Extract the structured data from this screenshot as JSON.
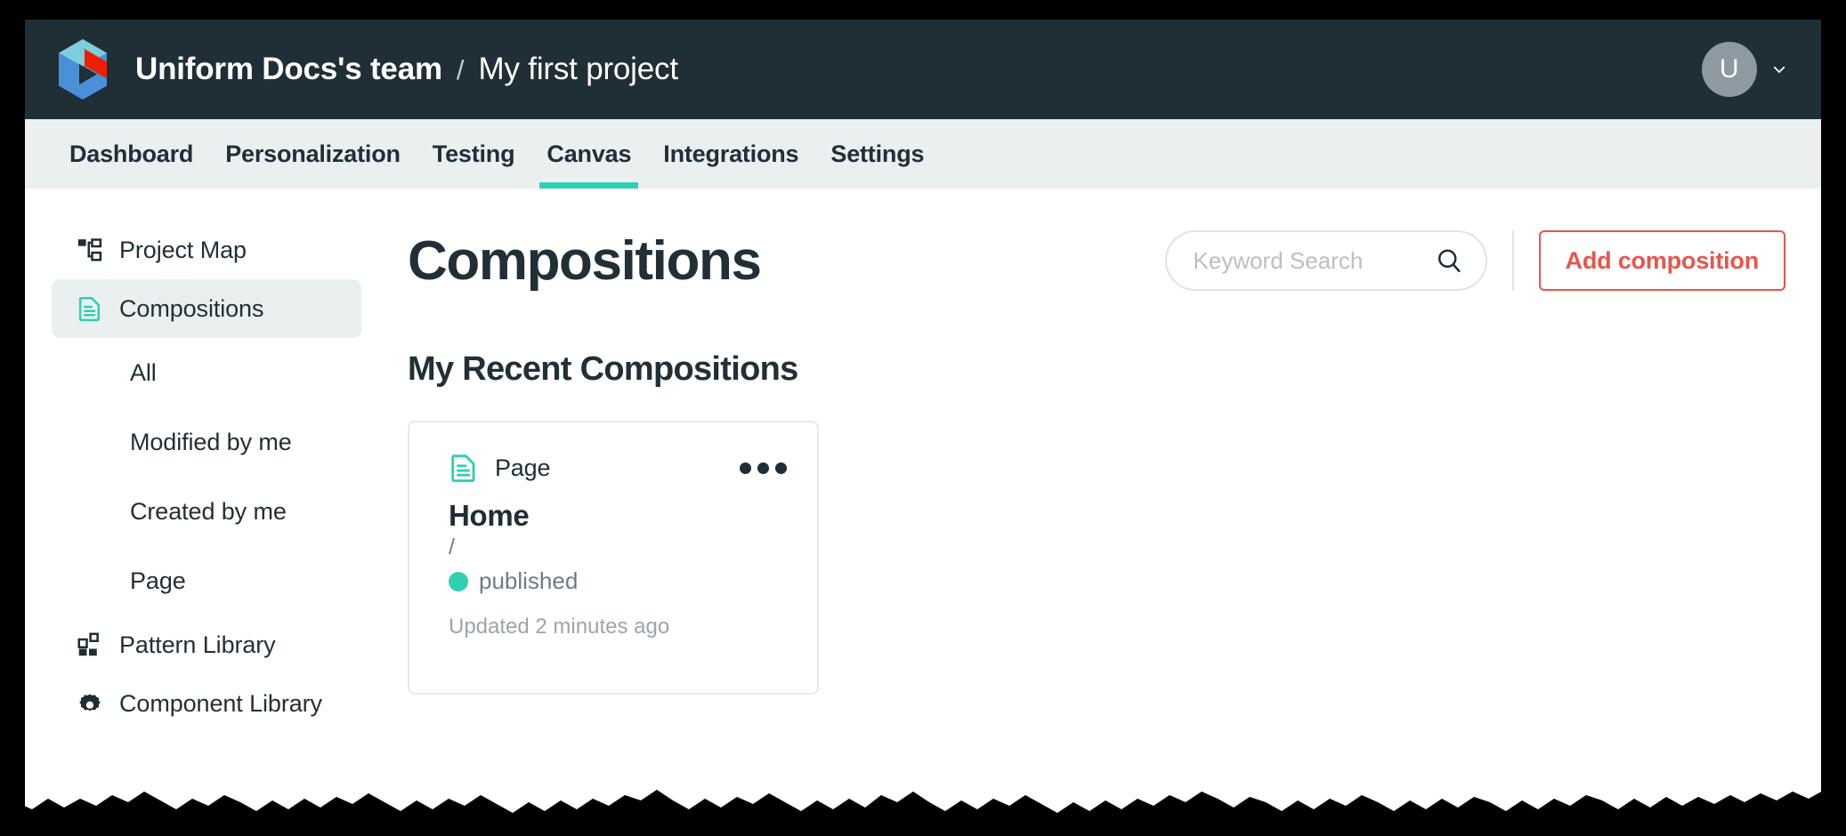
{
  "window": {
    "border_color": "#000000",
    "accent_teal": "#2fcfb4",
    "accent_red": "#e8554b",
    "header_bg": "#202e36",
    "nav_bg": "#eaf0f0"
  },
  "header": {
    "logo_icon": "uniform-hexagon-logo",
    "team_name": "Uniform Docs's team",
    "breadcrumb_separator": "/",
    "project_name": "My first project",
    "avatar_initial": "U",
    "avatar_chevron_icon": "chevron-down-icon"
  },
  "nav": {
    "items": [
      {
        "label": "Dashboard",
        "active": false
      },
      {
        "label": "Personalization",
        "active": false
      },
      {
        "label": "Testing",
        "active": false
      },
      {
        "label": "Canvas",
        "active": true
      },
      {
        "label": "Integrations",
        "active": false
      },
      {
        "label": "Settings",
        "active": false
      }
    ]
  },
  "sidebar": {
    "items": [
      {
        "label": "Project Map",
        "icon": "sitemap-icon",
        "active": false
      },
      {
        "label": "Compositions",
        "icon": "document-icon",
        "active": true
      }
    ],
    "sub_items": [
      {
        "label": "All"
      },
      {
        "label": "Modified by me"
      },
      {
        "label": "Created by me"
      },
      {
        "label": "Page"
      }
    ],
    "items_lower": [
      {
        "label": "Pattern Library",
        "icon": "blocks-icon",
        "active": false
      },
      {
        "label": "Component Library",
        "icon": "gear-icon",
        "active": false
      }
    ]
  },
  "main": {
    "page_title": "Compositions",
    "search": {
      "placeholder": "Keyword Search",
      "value": "",
      "icon": "search-icon"
    },
    "add_button_label": "Add composition",
    "section_title": "My Recent Compositions",
    "cards": [
      {
        "type_icon": "document-icon",
        "type_label": "Page",
        "menu_icon": "ellipsis-icon",
        "name": "Home",
        "path": "/",
        "status": "published",
        "status_color": "#2fcfb4",
        "updated": "Updated 2 minutes ago"
      }
    ]
  }
}
